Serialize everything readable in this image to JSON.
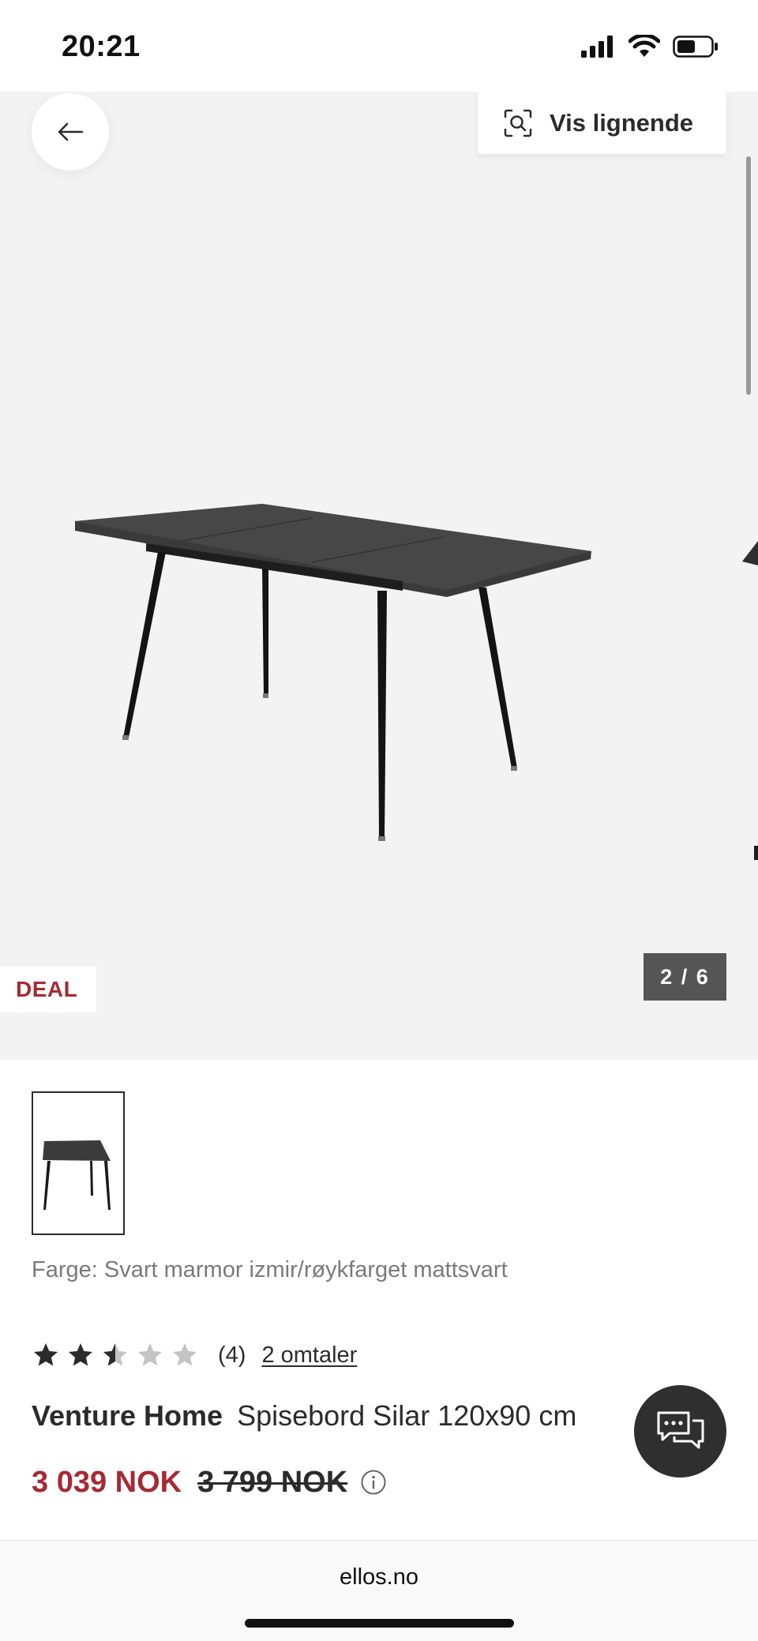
{
  "status_bar": {
    "time": "20:21",
    "icons": [
      "cellular-signal-icon",
      "wifi-icon",
      "battery-icon"
    ]
  },
  "gallery": {
    "similar_button_label": "Vis lignende",
    "badge": "DEAL",
    "counter": "2 / 6",
    "current_image": 2,
    "total_images": 6
  },
  "product": {
    "color_line": "Farge: Svart marmor izmir/røykfarget mattsvart",
    "rating": 2.5,
    "rating_max": 5,
    "rating_count": "(4)",
    "reviews_link": "2 omtaler",
    "brand": "Venture Home",
    "name": "Spisebord Silar 120x90 cm",
    "price_now": "3 039 NOK",
    "price_old": "3 799 NOK"
  },
  "browser": {
    "url": "ellos.no"
  },
  "colors": {
    "accent_red": "#a52a35",
    "text_dark": "#2b2b2b",
    "gallery_bg": "#f3f3f3",
    "chat_button": "#2f2f2f"
  }
}
